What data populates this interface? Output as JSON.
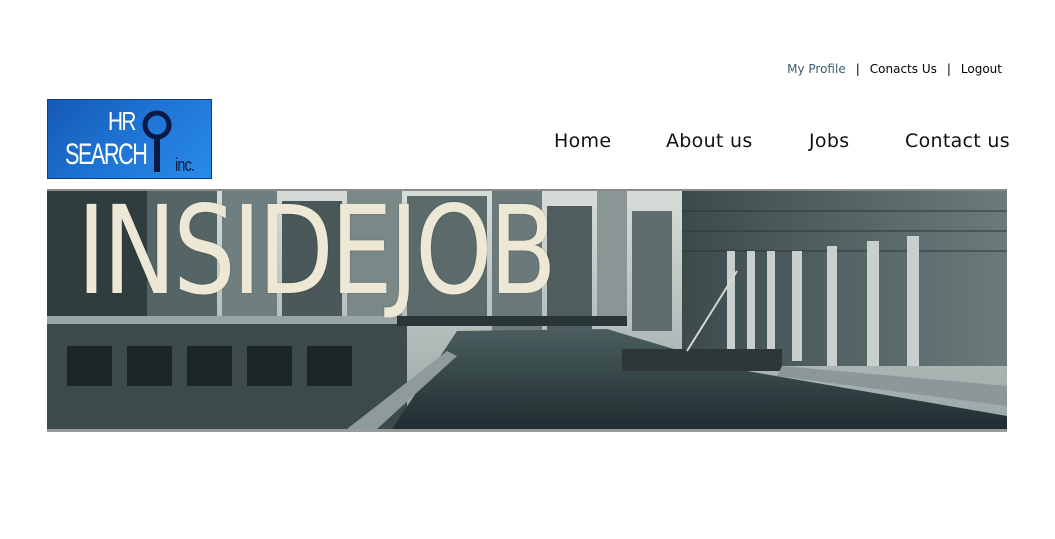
{
  "top_links": {
    "profile": "My Profile",
    "separator": "|",
    "contact": "Conacts Us",
    "logout": "Logout"
  },
  "logo": {
    "line1": "HR",
    "line2": "SEARCH",
    "suffix": "inc."
  },
  "nav": {
    "items": [
      {
        "label": "Home"
      },
      {
        "label": "About us"
      },
      {
        "label": "Jobs"
      },
      {
        "label": "Contact us"
      }
    ]
  },
  "banner": {
    "title": "INSIDEJOB"
  },
  "colors": {
    "profile_link": "#35606f",
    "logo_blue": "#1f77d8",
    "banner_text": "#ede8d5"
  }
}
